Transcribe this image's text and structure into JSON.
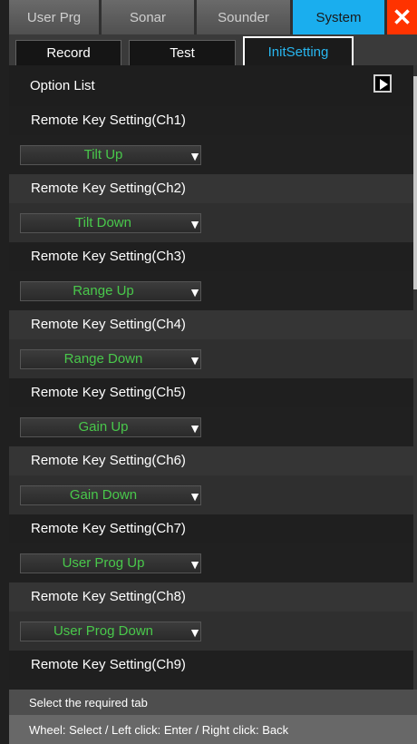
{
  "top_tabs": [
    "User Prg",
    "Sonar",
    "Sounder",
    "System"
  ],
  "sub_tabs": [
    "Record",
    "Test",
    "InitSetting"
  ],
  "option_list": {
    "title": "Option List"
  },
  "items": [
    {
      "label": "Remote Key Setting(Ch1)",
      "value": "Tilt Up"
    },
    {
      "label": "Remote Key Setting(Ch2)",
      "value": "Tilt Down"
    },
    {
      "label": "Remote Key Setting(Ch3)",
      "value": "Range Up"
    },
    {
      "label": "Remote Key Setting(Ch4)",
      "value": "Range Down"
    },
    {
      "label": "Remote Key Setting(Ch5)",
      "value": "Gain Up"
    },
    {
      "label": "Remote Key Setting(Ch6)",
      "value": "Gain Down"
    },
    {
      "label": "Remote Key Setting(Ch7)",
      "value": "User Prog Up"
    },
    {
      "label": "Remote Key Setting(Ch8)",
      "value": "User Prog Down"
    },
    {
      "label": "Remote Key Setting(Ch9)",
      "value": ""
    }
  ],
  "status": {
    "message": "Select the required tab",
    "help": "Wheel: Select / Left click: Enter / Right click: Back"
  },
  "icons": {
    "play": "play-icon",
    "close": "close-icon",
    "dropdown": "chevron-down-icon"
  },
  "colors": {
    "accent": "#1aaeee",
    "selected_value": "#49c84b",
    "close": "#ff3300"
  }
}
